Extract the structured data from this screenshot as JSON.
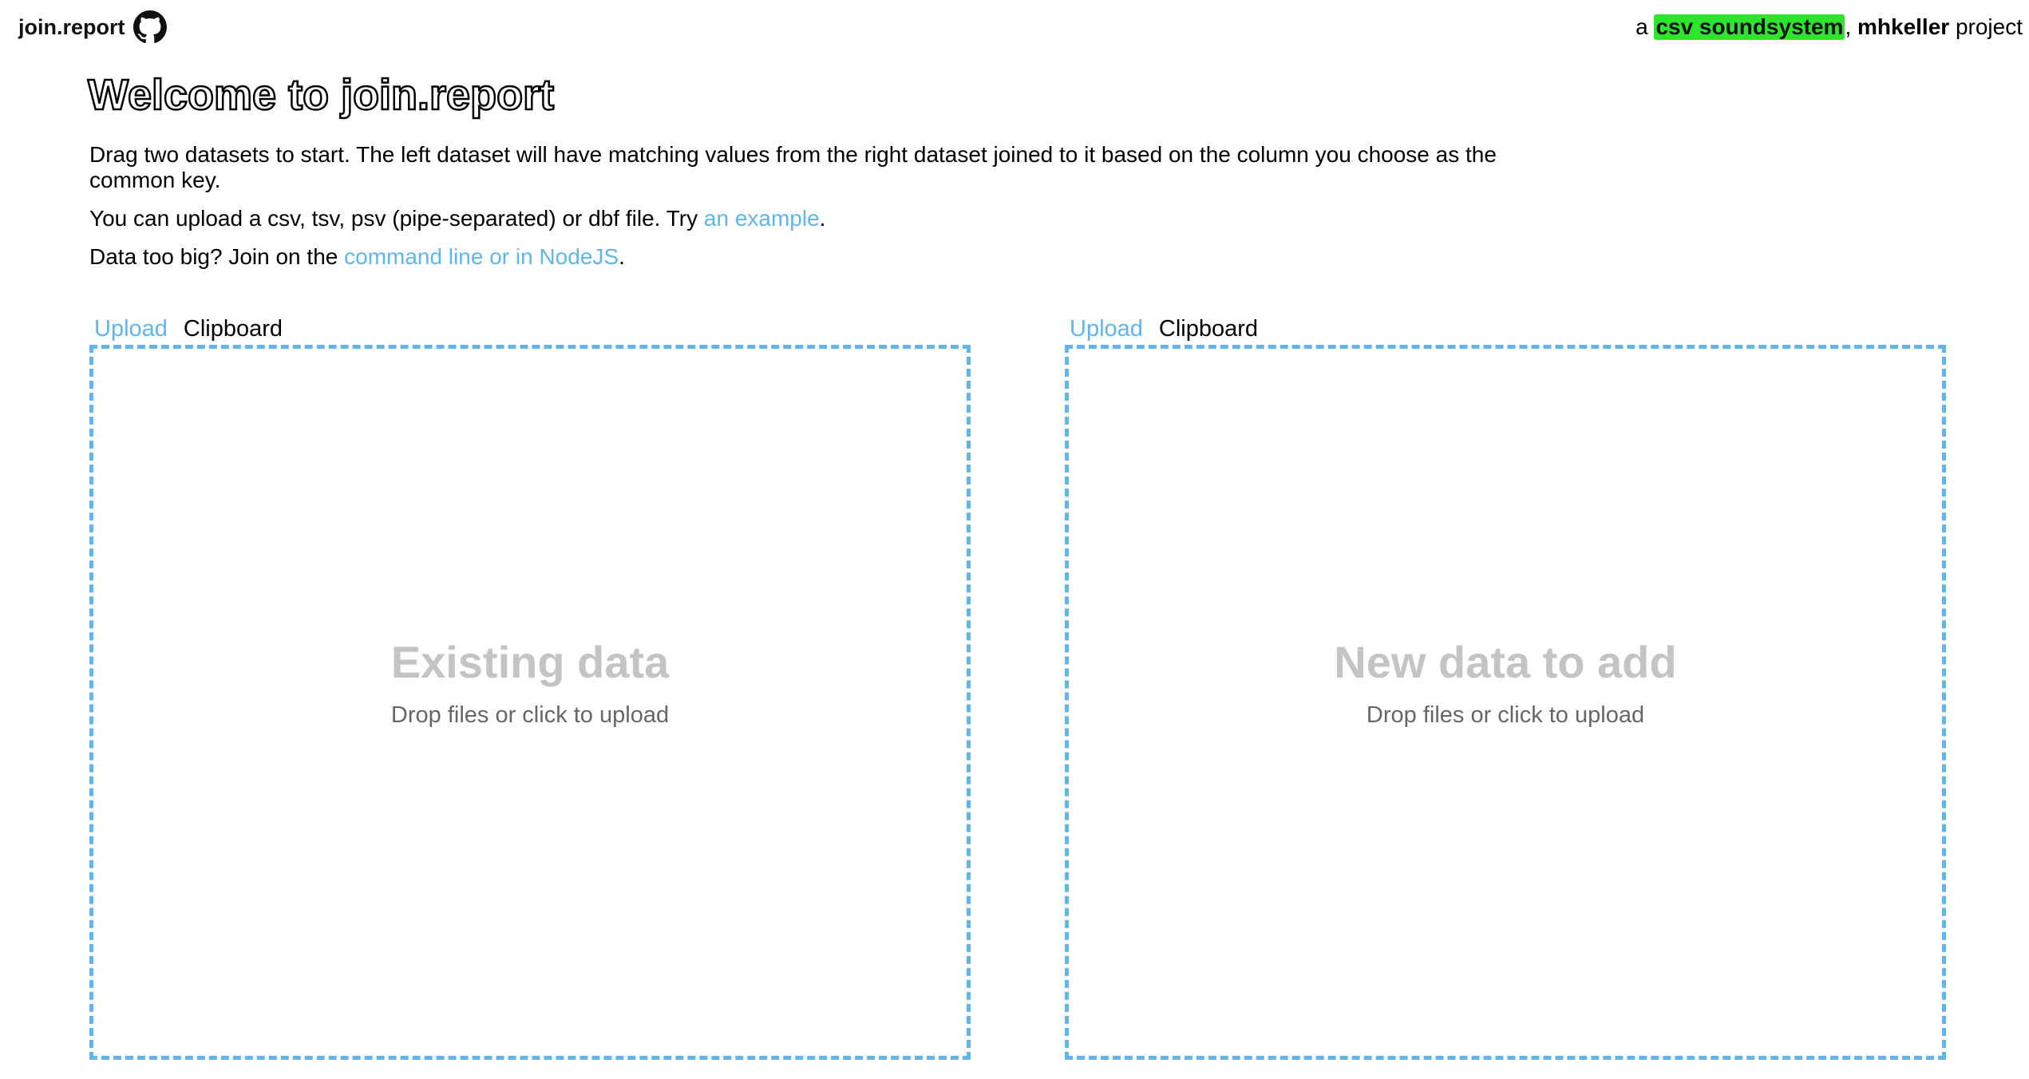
{
  "header": {
    "brand": "join.report",
    "github_icon": "github-icon",
    "credit_prefix": "a ",
    "credit_highlight": "csv soundsystem",
    "credit_sep": ", ",
    "credit_author": "mhkeller",
    "credit_suffix": " project",
    "highlight_color": "#2ee52e"
  },
  "main": {
    "title": "Welcome to join.report",
    "intro_p1": "Drag two datasets to start. The left dataset will have matching values from the right dataset joined to it based on the column you choose as the common key.",
    "intro_p2_text": "You can upload a csv, tsv, psv (pipe-separated) or dbf file. Try ",
    "intro_p2_link": "an example",
    "intro_p2_end": ".",
    "intro_p3_text": "Data too big? Join on the ",
    "intro_p3_link": "command line or in NodeJS",
    "intro_p3_end": "."
  },
  "panels": {
    "left": {
      "tab_upload": "Upload",
      "tab_clipboard": "Clipboard",
      "title": "Existing data",
      "subtitle": "Drop files or click to upload"
    },
    "right": {
      "tab_upload": "Upload",
      "tab_clipboard": "Clipboard",
      "title": "New data to add",
      "subtitle": "Drop files or click to upload"
    }
  },
  "colors": {
    "accent": "#5eb6ef",
    "placeholder_title": "#c4c4c4"
  }
}
